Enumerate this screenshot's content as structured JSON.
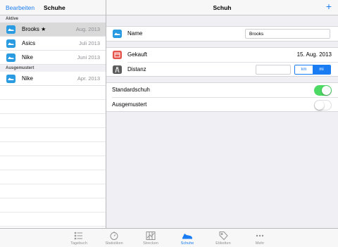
{
  "left_nav": {
    "edit_label": "Bearbeiten",
    "title": "Schuhe"
  },
  "right_nav": {
    "title": "Schuh",
    "add_label": "+"
  },
  "sections": {
    "active": {
      "header": "Aktive",
      "items": [
        {
          "name": "Brooks ★",
          "date": "Aug. 2013",
          "selected": true
        },
        {
          "name": "Asics",
          "date": "Juli 2013"
        },
        {
          "name": "Nike",
          "date": "Juni 2013"
        }
      ]
    },
    "retired": {
      "header": "Ausgemustert",
      "items": [
        {
          "name": "Nike",
          "date": "Apr. 2013"
        }
      ]
    }
  },
  "detail": {
    "name_label": "Name",
    "name_value": "Brooks",
    "bought_label": "Gekauft",
    "bought_value": "15. Aug. 2013",
    "distance_label": "Distanz",
    "distance_value": "",
    "unit_km": "km",
    "unit_mi": "mi",
    "selected_unit": "mi",
    "default_label": "Standardschuh",
    "default_on": true,
    "retired_label": "Ausgemustert",
    "retired_on": false
  },
  "tabs": [
    {
      "label": "Tagebuch",
      "icon": "list-icon"
    },
    {
      "label": "Statistiken",
      "icon": "stopwatch-icon"
    },
    {
      "label": "Strecken",
      "icon": "map-icon"
    },
    {
      "label": "Schuhe",
      "icon": "shoe-icon",
      "active": true
    },
    {
      "label": "Etiketten",
      "icon": "tag-icon"
    },
    {
      "label": "Mehr",
      "icon": "more-icon"
    }
  ],
  "colors": {
    "accent": "#1a7cf2",
    "toggle_on": "#4cd964",
    "shoe_icon_bg": "#2a9be0",
    "calendar_icon_bg": "#e5534b",
    "road_icon_bg": "#5b5b5b"
  }
}
